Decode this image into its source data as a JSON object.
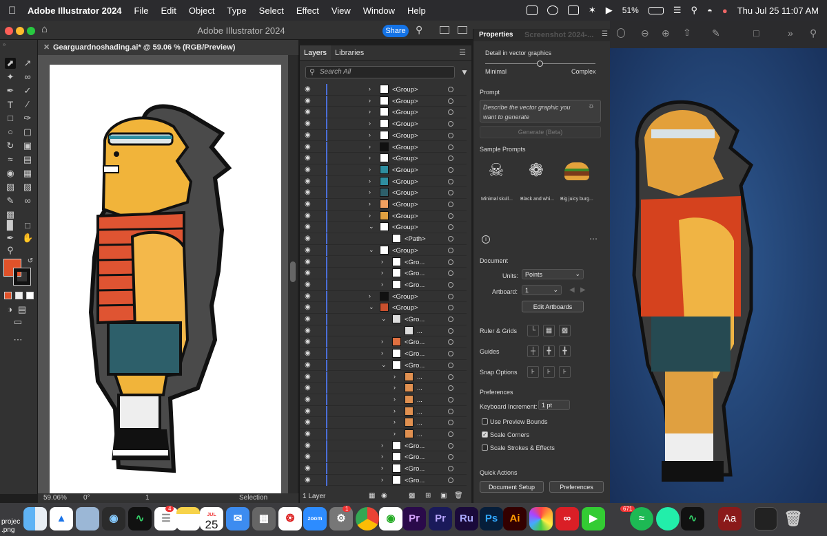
{
  "menubar": {
    "app": "Adobe Illustrator 2024",
    "items": [
      "File",
      "Edit",
      "Object",
      "Type",
      "Select",
      "Effect",
      "View",
      "Window",
      "Help"
    ],
    "battery": "51%",
    "datetime": "Thu Jul 25  11:07 AM"
  },
  "window": {
    "title": "Adobe Illustrator 2024",
    "share_label": "Share"
  },
  "document": {
    "tab_title": "Gearguardnoshading.ai* @ 59.06 % (RGB/Preview)"
  },
  "status": {
    "zoom": "59.06%",
    "rotation": "0°",
    "artboard": "1",
    "mode": "Selection"
  },
  "layers_panel": {
    "tabs": [
      "Layers",
      "Libraries"
    ],
    "search_placeholder": "Search All",
    "footer_count": "1 Layer",
    "rows": [
      {
        "label": "<Group>",
        "chev": "closed",
        "indent": 0
      },
      {
        "label": "<Group>",
        "chev": "closed",
        "indent": 0
      },
      {
        "label": "<Group>",
        "chev": "closed",
        "indent": 0
      },
      {
        "label": "<Group>",
        "chev": "closed",
        "indent": 0
      },
      {
        "label": "<Group>",
        "chev": "closed",
        "indent": 0
      },
      {
        "label": "<Group>",
        "chev": "closed",
        "indent": 0
      },
      {
        "label": "<Group>",
        "chev": "closed",
        "indent": 0
      },
      {
        "label": "<Group>",
        "chev": "closed",
        "indent": 0
      },
      {
        "label": "<Group>",
        "chev": "closed",
        "indent": 0
      },
      {
        "label": "<Group>",
        "chev": "closed",
        "indent": 0
      },
      {
        "label": "<Group>",
        "chev": "closed",
        "indent": 0
      },
      {
        "label": "<Group>",
        "chev": "closed",
        "indent": 0
      },
      {
        "label": "<Group>",
        "chev": "open",
        "indent": 0
      },
      {
        "label": "<Path>",
        "chev": "none",
        "indent": 1
      },
      {
        "label": "<Group>",
        "chev": "open",
        "indent": 0
      },
      {
        "label": "<Gro...",
        "chev": "closed",
        "indent": 1
      },
      {
        "label": "<Gro...",
        "chev": "closed",
        "indent": 1
      },
      {
        "label": "<Gro...",
        "chev": "closed",
        "indent": 1
      },
      {
        "label": "<Group>",
        "chev": "closed",
        "indent": 0
      },
      {
        "label": "<Group>",
        "chev": "open",
        "indent": 0
      },
      {
        "label": "<Gro...",
        "chev": "open",
        "indent": 1
      },
      {
        "label": "...",
        "chev": "none",
        "indent": 2
      },
      {
        "label": "<Gro...",
        "chev": "closed",
        "indent": 1
      },
      {
        "label": "<Gro...",
        "chev": "closed",
        "indent": 1
      },
      {
        "label": "<Gro...",
        "chev": "open",
        "indent": 1
      },
      {
        "label": "...",
        "chev": "closed",
        "indent": 2
      },
      {
        "label": "...",
        "chev": "closed",
        "indent": 2
      },
      {
        "label": "...",
        "chev": "closed",
        "indent": 2
      },
      {
        "label": "...",
        "chev": "closed",
        "indent": 2
      },
      {
        "label": "...",
        "chev": "closed",
        "indent": 2
      },
      {
        "label": "...",
        "chev": "closed",
        "indent": 2
      },
      {
        "label": "<Gro...",
        "chev": "closed",
        "indent": 1
      },
      {
        "label": "<Gro...",
        "chev": "closed",
        "indent": 1
      },
      {
        "label": "<Gro...",
        "chev": "closed",
        "indent": 1
      },
      {
        "label": "<Gro...",
        "chev": "closed",
        "indent": 1
      }
    ]
  },
  "properties_panel": {
    "tab_label": "Properties",
    "ghost_tab": "Screenshot 2024-...",
    "detail_label": "Detail in vector graphics",
    "slider_min": "Minimal",
    "slider_max": "Complex",
    "prompt_label": "Prompt",
    "prompt_placeholder": "Describe the vector graphic you want to generate",
    "generate_label": "Generate (Beta)",
    "sample_prompts_label": "Sample Prompts",
    "samples": [
      "Minimal skull...",
      "Black and whi...",
      "Big juicy burg..."
    ],
    "document_label": "Document",
    "units_label": "Units:",
    "units_value": "Points",
    "artboard_label": "Artboard:",
    "artboard_value": "1",
    "edit_artboards": "Edit Artboards",
    "ruler_grids": "Ruler & Grids",
    "guides": "Guides",
    "snap_options": "Snap Options",
    "preferences_label": "Preferences",
    "keyboard_increment_label": "Keyboard Increment:",
    "keyboard_increment_value": "1 pt",
    "use_preview_bounds": "Use Preview Bounds",
    "scale_corners": "Scale Corners",
    "scale_strokes": "Scale Strokes & Effects",
    "quick_actions": "Quick Actions",
    "document_setup": "Document Setup",
    "preferences_button": "Preferences"
  },
  "dock": {
    "calendar_month": "JUL",
    "calendar_day": "25",
    "badges": {
      "reminders": "4",
      "settings": "1",
      "photos": "671"
    },
    "labels": [
      "Pr",
      "Pr",
      "Ru",
      "Ps",
      "Ai",
      "Aa"
    ]
  },
  "desktop": {
    "file_label_1": "projec",
    "file_label_2": ".png"
  }
}
